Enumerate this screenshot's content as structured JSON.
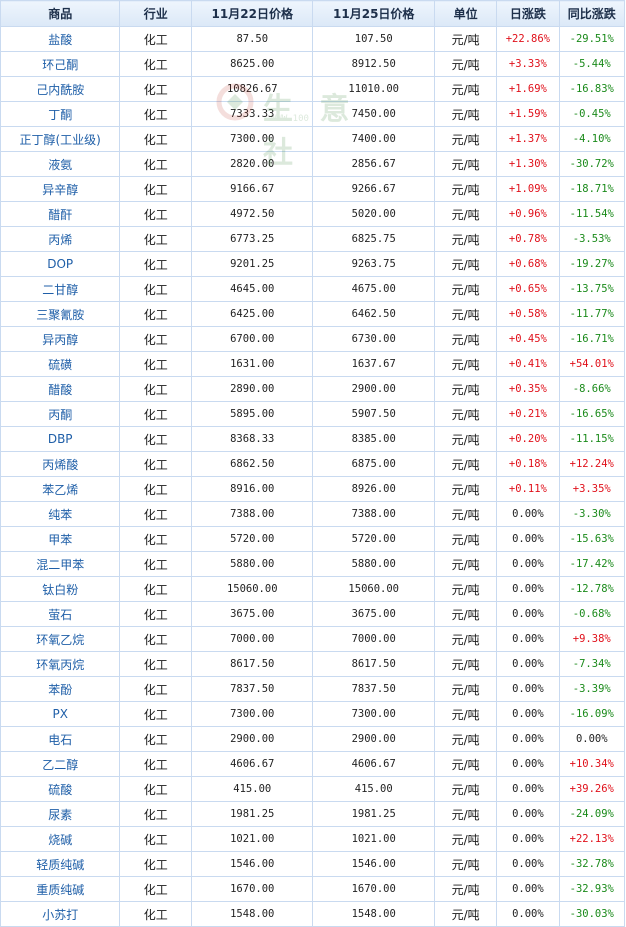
{
  "headers": [
    "商品",
    "行业",
    "11月22日价格",
    "11月25日价格",
    "单位",
    "日涨跌",
    "同比涨跌"
  ],
  "watermark": {
    "text": "生 意 社",
    "url": "WWW.100"
  },
  "colors": {
    "up": "#e0101a",
    "down": "#1a8a1a",
    "name": "#1f5fa8",
    "border": "#c9daf0"
  },
  "rows": [
    {
      "name": "盐酸",
      "industry": "化工",
      "p1": "87.50",
      "p2": "107.50",
      "unit": "元/吨",
      "daily": "+22.86%",
      "yoy": "-29.51%"
    },
    {
      "name": "环己酮",
      "industry": "化工",
      "p1": "8625.00",
      "p2": "8912.50",
      "unit": "元/吨",
      "daily": "+3.33%",
      "yoy": "-5.44%"
    },
    {
      "name": "己内酰胺",
      "industry": "化工",
      "p1": "10826.67",
      "p2": "11010.00",
      "unit": "元/吨",
      "daily": "+1.69%",
      "yoy": "-16.83%"
    },
    {
      "name": "丁酮",
      "industry": "化工",
      "p1": "7333.33",
      "p2": "7450.00",
      "unit": "元/吨",
      "daily": "+1.59%",
      "yoy": "-0.45%"
    },
    {
      "name": "正丁醇(工业级)",
      "industry": "化工",
      "p1": "7300.00",
      "p2": "7400.00",
      "unit": "元/吨",
      "daily": "+1.37%",
      "yoy": "-4.10%"
    },
    {
      "name": "液氨",
      "industry": "化工",
      "p1": "2820.00",
      "p2": "2856.67",
      "unit": "元/吨",
      "daily": "+1.30%",
      "yoy": "-30.72%"
    },
    {
      "name": "异辛醇",
      "industry": "化工",
      "p1": "9166.67",
      "p2": "9266.67",
      "unit": "元/吨",
      "daily": "+1.09%",
      "yoy": "-18.71%"
    },
    {
      "name": "醋酐",
      "industry": "化工",
      "p1": "4972.50",
      "p2": "5020.00",
      "unit": "元/吨",
      "daily": "+0.96%",
      "yoy": "-11.54%"
    },
    {
      "name": "丙烯",
      "industry": "化工",
      "p1": "6773.25",
      "p2": "6825.75",
      "unit": "元/吨",
      "daily": "+0.78%",
      "yoy": "-3.53%"
    },
    {
      "name": "DOP",
      "industry": "化工",
      "p1": "9201.25",
      "p2": "9263.75",
      "unit": "元/吨",
      "daily": "+0.68%",
      "yoy": "-19.27%"
    },
    {
      "name": "二甘醇",
      "industry": "化工",
      "p1": "4645.00",
      "p2": "4675.00",
      "unit": "元/吨",
      "daily": "+0.65%",
      "yoy": "-13.75%"
    },
    {
      "name": "三聚氰胺",
      "industry": "化工",
      "p1": "6425.00",
      "p2": "6462.50",
      "unit": "元/吨",
      "daily": "+0.58%",
      "yoy": "-11.77%"
    },
    {
      "name": "异丙醇",
      "industry": "化工",
      "p1": "6700.00",
      "p2": "6730.00",
      "unit": "元/吨",
      "daily": "+0.45%",
      "yoy": "-16.71%"
    },
    {
      "name": "硫磺",
      "industry": "化工",
      "p1": "1631.00",
      "p2": "1637.67",
      "unit": "元/吨",
      "daily": "+0.41%",
      "yoy": "+54.01%"
    },
    {
      "name": "醋酸",
      "industry": "化工",
      "p1": "2890.00",
      "p2": "2900.00",
      "unit": "元/吨",
      "daily": "+0.35%",
      "yoy": "-8.66%"
    },
    {
      "name": "丙酮",
      "industry": "化工",
      "p1": "5895.00",
      "p2": "5907.50",
      "unit": "元/吨",
      "daily": "+0.21%",
      "yoy": "-16.65%"
    },
    {
      "name": "DBP",
      "industry": "化工",
      "p1": "8368.33",
      "p2": "8385.00",
      "unit": "元/吨",
      "daily": "+0.20%",
      "yoy": "-11.15%"
    },
    {
      "name": "丙烯酸",
      "industry": "化工",
      "p1": "6862.50",
      "p2": "6875.00",
      "unit": "元/吨",
      "daily": "+0.18%",
      "yoy": "+12.24%"
    },
    {
      "name": "苯乙烯",
      "industry": "化工",
      "p1": "8916.00",
      "p2": "8926.00",
      "unit": "元/吨",
      "daily": "+0.11%",
      "yoy": "+3.35%"
    },
    {
      "name": "纯苯",
      "industry": "化工",
      "p1": "7388.00",
      "p2": "7388.00",
      "unit": "元/吨",
      "daily": "0.00%",
      "yoy": "-3.30%"
    },
    {
      "name": "甲苯",
      "industry": "化工",
      "p1": "5720.00",
      "p2": "5720.00",
      "unit": "元/吨",
      "daily": "0.00%",
      "yoy": "-15.63%"
    },
    {
      "name": "混二甲苯",
      "industry": "化工",
      "p1": "5880.00",
      "p2": "5880.00",
      "unit": "元/吨",
      "daily": "0.00%",
      "yoy": "-17.42%"
    },
    {
      "name": "钛白粉",
      "industry": "化工",
      "p1": "15060.00",
      "p2": "15060.00",
      "unit": "元/吨",
      "daily": "0.00%",
      "yoy": "-12.78%"
    },
    {
      "name": "萤石",
      "industry": "化工",
      "p1": "3675.00",
      "p2": "3675.00",
      "unit": "元/吨",
      "daily": "0.00%",
      "yoy": "-0.68%"
    },
    {
      "name": "环氧乙烷",
      "industry": "化工",
      "p1": "7000.00",
      "p2": "7000.00",
      "unit": "元/吨",
      "daily": "0.00%",
      "yoy": "+9.38%"
    },
    {
      "name": "环氧丙烷",
      "industry": "化工",
      "p1": "8617.50",
      "p2": "8617.50",
      "unit": "元/吨",
      "daily": "0.00%",
      "yoy": "-7.34%"
    },
    {
      "name": "苯酚",
      "industry": "化工",
      "p1": "7837.50",
      "p2": "7837.50",
      "unit": "元/吨",
      "daily": "0.00%",
      "yoy": "-3.39%"
    },
    {
      "name": "PX",
      "industry": "化工",
      "p1": "7300.00",
      "p2": "7300.00",
      "unit": "元/吨",
      "daily": "0.00%",
      "yoy": "-16.09%"
    },
    {
      "name": "电石",
      "industry": "化工",
      "p1": "2900.00",
      "p2": "2900.00",
      "unit": "元/吨",
      "daily": "0.00%",
      "yoy": "0.00%"
    },
    {
      "name": "乙二醇",
      "industry": "化工",
      "p1": "4606.67",
      "p2": "4606.67",
      "unit": "元/吨",
      "daily": "0.00%",
      "yoy": "+10.34%"
    },
    {
      "name": "硫酸",
      "industry": "化工",
      "p1": "415.00",
      "p2": "415.00",
      "unit": "元/吨",
      "daily": "0.00%",
      "yoy": "+39.26%"
    },
    {
      "name": "尿素",
      "industry": "化工",
      "p1": "1981.25",
      "p2": "1981.25",
      "unit": "元/吨",
      "daily": "0.00%",
      "yoy": "-24.09%"
    },
    {
      "name": "烧碱",
      "industry": "化工",
      "p1": "1021.00",
      "p2": "1021.00",
      "unit": "元/吨",
      "daily": "0.00%",
      "yoy": "+22.13%"
    },
    {
      "name": "轻质纯碱",
      "industry": "化工",
      "p1": "1546.00",
      "p2": "1546.00",
      "unit": "元/吨",
      "daily": "0.00%",
      "yoy": "-32.78%"
    },
    {
      "name": "重质纯碱",
      "industry": "化工",
      "p1": "1670.00",
      "p2": "1670.00",
      "unit": "元/吨",
      "daily": "0.00%",
      "yoy": "-32.93%"
    },
    {
      "name": "小苏打",
      "industry": "化工",
      "p1": "1548.00",
      "p2": "1548.00",
      "unit": "元/吨",
      "daily": "0.00%",
      "yoy": "-30.03%"
    }
  ]
}
